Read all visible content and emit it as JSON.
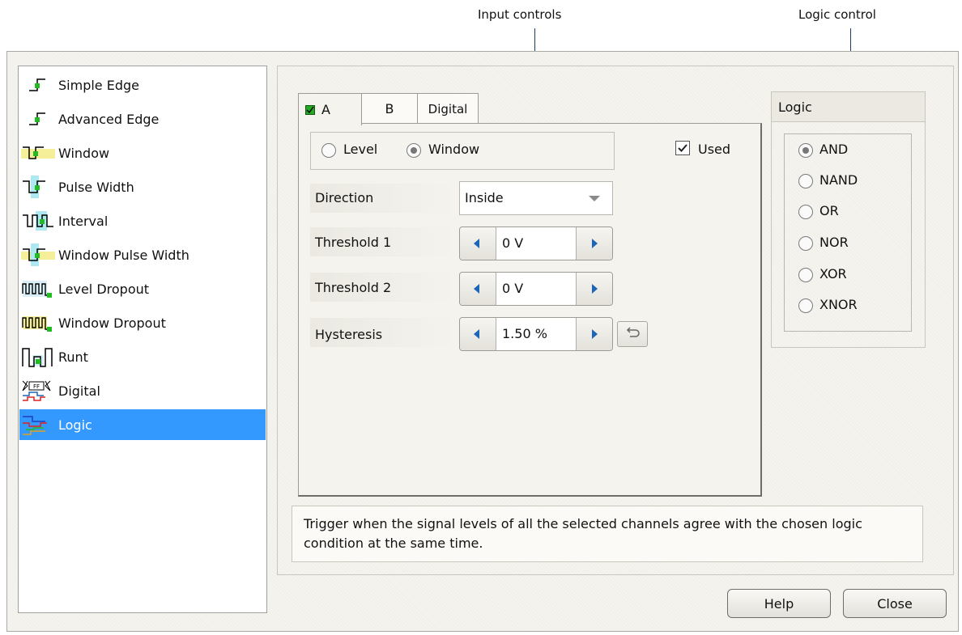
{
  "callouts": {
    "input_controls": "Input controls",
    "logic_control": "Logic control"
  },
  "trigger_types": [
    {
      "label": "Simple Edge",
      "icon": "simple-edge-icon"
    },
    {
      "label": "Advanced Edge",
      "icon": "advanced-edge-icon"
    },
    {
      "label": "Window",
      "icon": "window-icon"
    },
    {
      "label": "Pulse Width",
      "icon": "pulse-width-icon"
    },
    {
      "label": "Interval",
      "icon": "interval-icon"
    },
    {
      "label": "Window Pulse Width",
      "icon": "window-pulse-width-icon"
    },
    {
      "label": "Level Dropout",
      "icon": "level-dropout-icon"
    },
    {
      "label": "Window Dropout",
      "icon": "window-dropout-icon"
    },
    {
      "label": "Runt",
      "icon": "runt-icon"
    },
    {
      "label": "Digital",
      "icon": "digital-icon"
    },
    {
      "label": "Logic",
      "icon": "logic-icon",
      "selected": true
    }
  ],
  "tabs": {
    "a": "A",
    "b": "B",
    "digital": "Digital",
    "active": "A"
  },
  "mode": {
    "level": "Level",
    "window": "Window",
    "selected": "Window"
  },
  "used": {
    "label": "Used",
    "checked": true
  },
  "fields": {
    "direction": {
      "label": "Direction",
      "value": "Inside"
    },
    "threshold1": {
      "label": "Threshold 1",
      "value": "0 V"
    },
    "threshold2": {
      "label": "Threshold 2",
      "value": "0 V"
    },
    "hysteresis": {
      "label": "Hysteresis",
      "value": "1.50 %"
    }
  },
  "logic": {
    "title": "Logic",
    "options": [
      "AND",
      "NAND",
      "OR",
      "NOR",
      "XOR",
      "XNOR"
    ],
    "selected": "AND"
  },
  "description": "Trigger when the signal levels of all the selected channels agree with the chosen logic condition at the same time.",
  "buttons": {
    "help": "Help",
    "close": "Close"
  },
  "colors": {
    "selection": "#3399ff",
    "icon_green": "#22bb22",
    "accent_blue": "#1b66b8"
  }
}
